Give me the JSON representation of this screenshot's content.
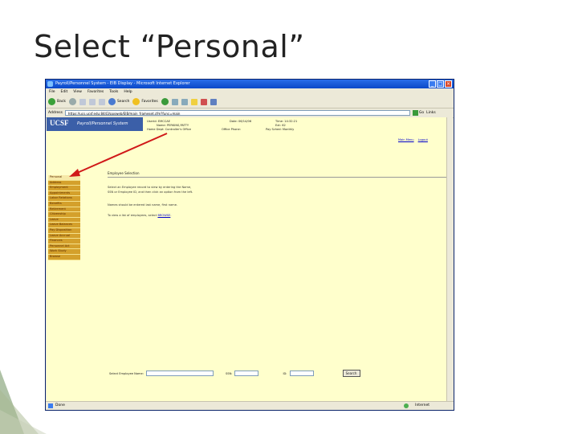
{
  "slide": {
    "title": "Select “Personal”"
  },
  "browser": {
    "title": "Payroll/Personnel System - EIB Display - Microsoft Internet Explorer",
    "menu": [
      "File",
      "Edit",
      "View",
      "Favorites",
      "Tools",
      "Help"
    ],
    "toolbar": {
      "back": "Back",
      "search": "Search",
      "favorites": "Favorites"
    },
    "address_label": "Address",
    "address": "https://ucs.ucsf.edu:8443/ppsweb/EIB/main_frameset.cfm?func=main",
    "go_label": "Go",
    "links_label": "Links",
    "status_done": "Done",
    "status_zone": "Internet"
  },
  "page": {
    "banner": {
      "logo": "UCSF",
      "system": "Payroll/Personnel System"
    },
    "header_info": [
      {
        "label": "Userid:",
        "value": "EMCCAE"
      },
      {
        "label": "Date:",
        "value": "06/14/06"
      },
      {
        "label": "Time:",
        "value": "14:32:21"
      },
      {
        "label": "Name:",
        "value": "PERKINS,PATTY"
      },
      {
        "label": "Ext:",
        "value": "62"
      },
      {
        "label": "Home Dept:",
        "value": "Controller's Office"
      },
      {
        "label": "Office Phone:",
        "value": ""
      },
      {
        "label": "Pay Sched:",
        "value": "Monthly"
      }
    ],
    "links": [
      "Main Menu",
      "Logout"
    ],
    "nav_items": [
      "Personal",
      "Address",
      "Employment",
      "Appointments",
      "Labor Relations",
      "Benefits",
      "Retirement",
      "Citizenship",
      "Leave",
      "Leave Balances",
      "Pay Disposition",
      "Leave Accrual",
      "Finances",
      "Personnel Act",
      "Work Study",
      "Browse"
    ],
    "active_nav": "Personal",
    "section_title": "Employee Selection",
    "instructions": [
      "Select an Employee record to view by entering the Name,",
      "SSN or Employee ID, and then click an option from the left."
    ],
    "name_note": "Names should be entered last name, first name.",
    "list_prefix": "To view a list of employees, select",
    "list_link": "BROWSE",
    "search": {
      "name_label": "Select Employee Name:",
      "ssn_label": "SSN:",
      "id_label": "ID:",
      "button": "Search"
    }
  },
  "colors": {
    "page_bg": "#ffffcc",
    "nav_bg": "#d4a02b",
    "banner_bg": "#3b5fa8",
    "arrow": "#d01818"
  }
}
